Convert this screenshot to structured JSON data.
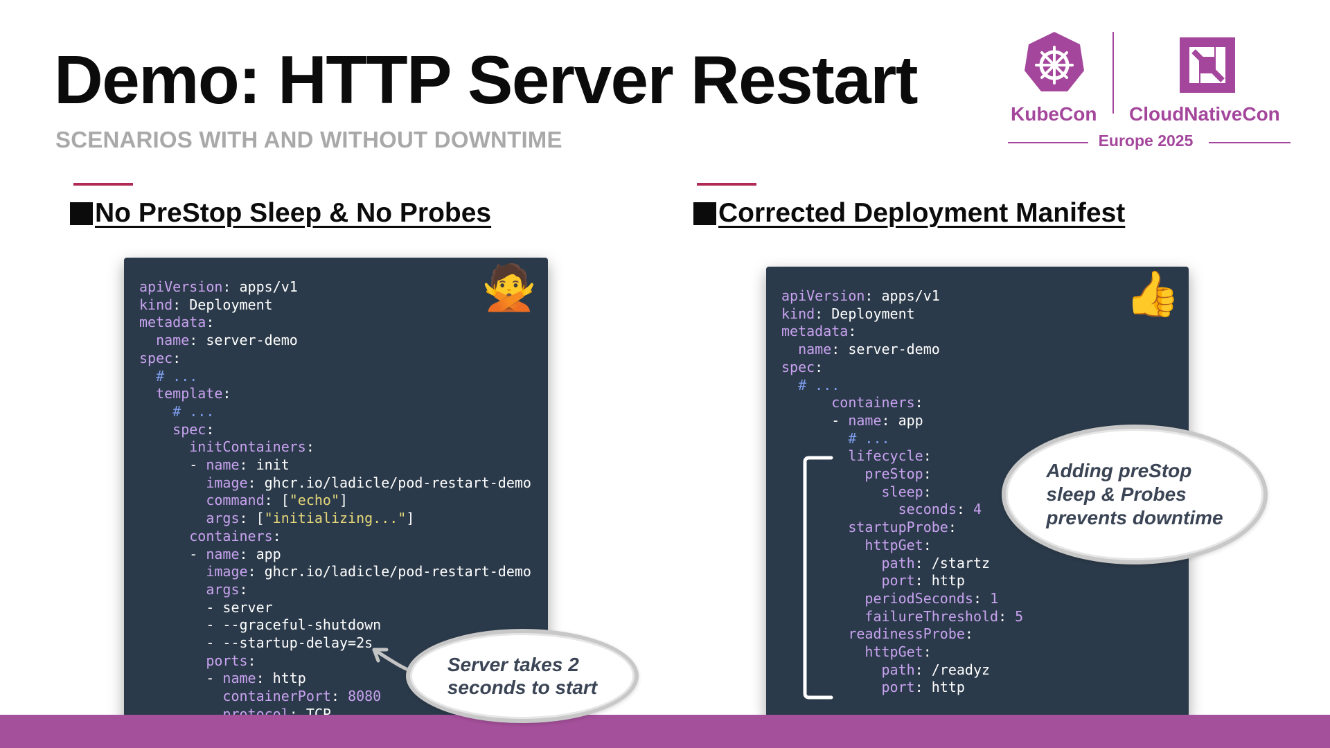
{
  "slide": {
    "title": "Demo: HTTP Server Restart",
    "subtitle": "SCENARIOS WITH AND WITHOUT DOWNTIME"
  },
  "logo": {
    "left_text": "KubeCon",
    "right_text": "CloudNativeCon",
    "event": "Europe 2025",
    "accent_color": "#a4479c"
  },
  "left_panel": {
    "heading": "No PreStop Sleep & No Probes",
    "emoji": "🙅",
    "callout": "Server takes 2\nseconds to start"
  },
  "right_panel": {
    "heading": "Corrected Deployment Manifest",
    "emoji": "👍",
    "callout": "Adding preStop\nsleep & Probes\nprevents downtime"
  },
  "colors": {
    "code_bg": "#2b3a4a",
    "key": "#c8a3f0",
    "comment": "#7f9ff0",
    "string": "#e6d87a",
    "bar": "#a5509b",
    "accent_line": "#b02a54"
  },
  "left_code": [
    [
      [
        "k",
        "apiVersion"
      ],
      [
        "t",
        ": apps/v1"
      ]
    ],
    [
      [
        "k",
        "kind"
      ],
      [
        "t",
        ": Deployment"
      ]
    ],
    [
      [
        "k",
        "metadata"
      ],
      [
        "t",
        ":"
      ]
    ],
    [
      [
        "t",
        "  "
      ],
      [
        "k",
        "name"
      ],
      [
        "t",
        ": server-demo"
      ]
    ],
    [
      [
        "k",
        "spec"
      ],
      [
        "t",
        ":"
      ]
    ],
    [
      [
        "c",
        "  # ..."
      ]
    ],
    [
      [
        "t",
        "  "
      ],
      [
        "k",
        "template"
      ],
      [
        "t",
        ":"
      ]
    ],
    [
      [
        "c",
        "    # ..."
      ]
    ],
    [
      [
        "t",
        "    "
      ],
      [
        "k",
        "spec"
      ],
      [
        "t",
        ":"
      ]
    ],
    [
      [
        "t",
        "      "
      ],
      [
        "k",
        "initContainers"
      ],
      [
        "t",
        ":"
      ]
    ],
    [
      [
        "t",
        "      - "
      ],
      [
        "k",
        "name"
      ],
      [
        "t",
        ": init"
      ]
    ],
    [
      [
        "t",
        "        "
      ],
      [
        "k",
        "image"
      ],
      [
        "t",
        ": ghcr.io/ladicle/pod-restart-demo"
      ]
    ],
    [
      [
        "t",
        "        "
      ],
      [
        "k",
        "command"
      ],
      [
        "t",
        ": ["
      ],
      [
        "s",
        "\"echo\""
      ],
      [
        "t",
        "]"
      ]
    ],
    [
      [
        "t",
        "        "
      ],
      [
        "k",
        "args"
      ],
      [
        "t",
        ": ["
      ],
      [
        "s",
        "\"initializing...\""
      ],
      [
        "t",
        "]"
      ]
    ],
    [
      [
        "t",
        "      "
      ],
      [
        "k",
        "containers"
      ],
      [
        "t",
        ":"
      ]
    ],
    [
      [
        "t",
        "      - "
      ],
      [
        "k",
        "name"
      ],
      [
        "t",
        ": app"
      ]
    ],
    [
      [
        "t",
        "        "
      ],
      [
        "k",
        "image"
      ],
      [
        "t",
        ": ghcr.io/ladicle/pod-restart-demo"
      ]
    ],
    [
      [
        "t",
        "        "
      ],
      [
        "k",
        "args"
      ],
      [
        "t",
        ":"
      ]
    ],
    [
      [
        "t",
        "        - server"
      ]
    ],
    [
      [
        "t",
        "        - --graceful-shutdown"
      ]
    ],
    [
      [
        "t",
        "        - --startup-delay=2s"
      ]
    ],
    [
      [
        "t",
        "        "
      ],
      [
        "k",
        "ports"
      ],
      [
        "t",
        ":"
      ]
    ],
    [
      [
        "t",
        "        - "
      ],
      [
        "k",
        "name"
      ],
      [
        "t",
        ": http"
      ]
    ],
    [
      [
        "t",
        "          "
      ],
      [
        "k",
        "containerPort"
      ],
      [
        "t",
        ": "
      ],
      [
        "n",
        "8080"
      ]
    ],
    [
      [
        "t",
        "          "
      ],
      [
        "k",
        "protocol"
      ],
      [
        "t",
        ": TCP"
      ]
    ]
  ],
  "right_code": [
    [
      [
        "k",
        "apiVersion"
      ],
      [
        "t",
        ": apps/v1"
      ]
    ],
    [
      [
        "k",
        "kind"
      ],
      [
        "t",
        ": Deployment"
      ]
    ],
    [
      [
        "k",
        "metadata"
      ],
      [
        "t",
        ":"
      ]
    ],
    [
      [
        "t",
        "  "
      ],
      [
        "k",
        "name"
      ],
      [
        "t",
        ": server-demo"
      ]
    ],
    [
      [
        "k",
        "spec"
      ],
      [
        "t",
        ":"
      ]
    ],
    [
      [
        "c",
        "  # ..."
      ]
    ],
    [
      [
        "t",
        "      "
      ],
      [
        "k",
        "containers"
      ],
      [
        "t",
        ":"
      ]
    ],
    [
      [
        "t",
        "      - "
      ],
      [
        "k",
        "name"
      ],
      [
        "t",
        ": app"
      ]
    ],
    [
      [
        "c",
        "        # ..."
      ]
    ],
    [
      [
        "t",
        "        "
      ],
      [
        "k",
        "lifecycle"
      ],
      [
        "t",
        ":"
      ]
    ],
    [
      [
        "t",
        "          "
      ],
      [
        "k",
        "preStop"
      ],
      [
        "t",
        ":"
      ]
    ],
    [
      [
        "t",
        "            "
      ],
      [
        "k",
        "sleep"
      ],
      [
        "t",
        ":"
      ]
    ],
    [
      [
        "t",
        "              "
      ],
      [
        "k",
        "seconds"
      ],
      [
        "t",
        ": "
      ],
      [
        "n",
        "4"
      ]
    ],
    [
      [
        "t",
        "        "
      ],
      [
        "k",
        "startupProbe"
      ],
      [
        "t",
        ":"
      ]
    ],
    [
      [
        "t",
        "          "
      ],
      [
        "k",
        "httpGet"
      ],
      [
        "t",
        ":"
      ]
    ],
    [
      [
        "t",
        "            "
      ],
      [
        "k",
        "path"
      ],
      [
        "t",
        ": /startz"
      ]
    ],
    [
      [
        "t",
        "            "
      ],
      [
        "k",
        "port"
      ],
      [
        "t",
        ": http"
      ]
    ],
    [
      [
        "t",
        "          "
      ],
      [
        "k",
        "periodSeconds"
      ],
      [
        "t",
        ": "
      ],
      [
        "n",
        "1"
      ]
    ],
    [
      [
        "t",
        "          "
      ],
      [
        "k",
        "failureThreshold"
      ],
      [
        "t",
        ": "
      ],
      [
        "n",
        "5"
      ]
    ],
    [
      [
        "t",
        "        "
      ],
      [
        "k",
        "readinessProbe"
      ],
      [
        "t",
        ":"
      ]
    ],
    [
      [
        "t",
        "          "
      ],
      [
        "k",
        "httpGet"
      ],
      [
        "t",
        ":"
      ]
    ],
    [
      [
        "t",
        "            "
      ],
      [
        "k",
        "path"
      ],
      [
        "t",
        ": /readyz"
      ]
    ],
    [
      [
        "t",
        "            "
      ],
      [
        "k",
        "port"
      ],
      [
        "t",
        ": http"
      ]
    ]
  ]
}
